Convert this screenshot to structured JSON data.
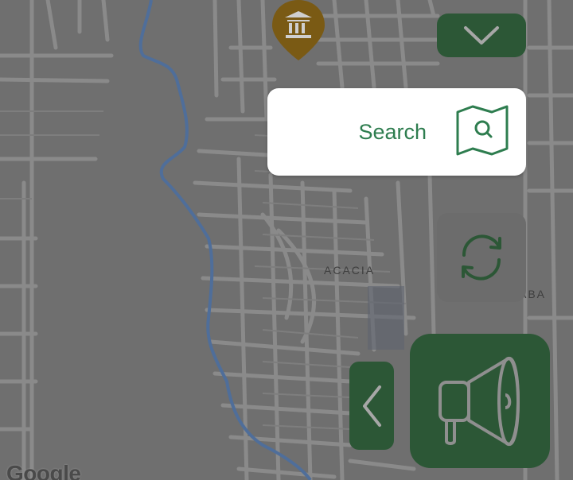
{
  "map": {
    "place_label": "ACACIA",
    "place_label_partial": "ABA",
    "attribution": "Google",
    "poi": "museum-pin-icon"
  },
  "controls": {
    "collapse_icon": "chevron-down-icon",
    "search_label": "Search",
    "search_icon": "map-search-icon",
    "refresh_icon": "refresh-icon",
    "back_icon": "chevron-left-icon",
    "announce_icon": "megaphone-icon"
  },
  "colors": {
    "accent_dark_green": "#2c5736",
    "text_green": "#2e7d4f",
    "map_overlay": "#6f6f6f",
    "river": "#4f6e9a",
    "poi_pin": "#7a5a14"
  }
}
